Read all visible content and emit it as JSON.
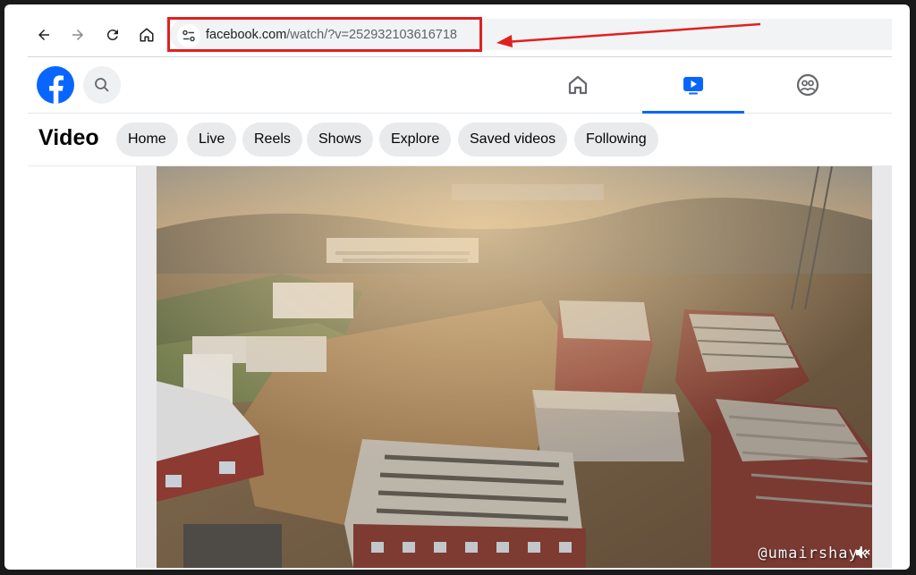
{
  "browser": {
    "url_host": "facebook.com",
    "url_path": "/watch/?v=252932103616718"
  },
  "facebook": {
    "page_title": "Video",
    "nav_pills": [
      "Home",
      "Live",
      "Reels",
      "Shows",
      "Explore",
      "Saved videos",
      "Following"
    ],
    "top_tabs": [
      "home-tab",
      "video-tab",
      "groups-tab"
    ],
    "active_tab": "video-tab"
  },
  "video": {
    "watermark": "@umairshayk"
  },
  "colors": {
    "brand_blue": "#0866ff",
    "annotation_red": "#e02020",
    "pill_bg": "#e9eaec"
  },
  "icons": [
    "back-arrow-icon",
    "forward-arrow-icon",
    "reload-icon",
    "home-icon",
    "site-info-icon",
    "facebook-logo-icon",
    "search-icon",
    "home-tab-icon",
    "video-tab-icon",
    "groups-tab-icon",
    "mute-icon"
  ]
}
